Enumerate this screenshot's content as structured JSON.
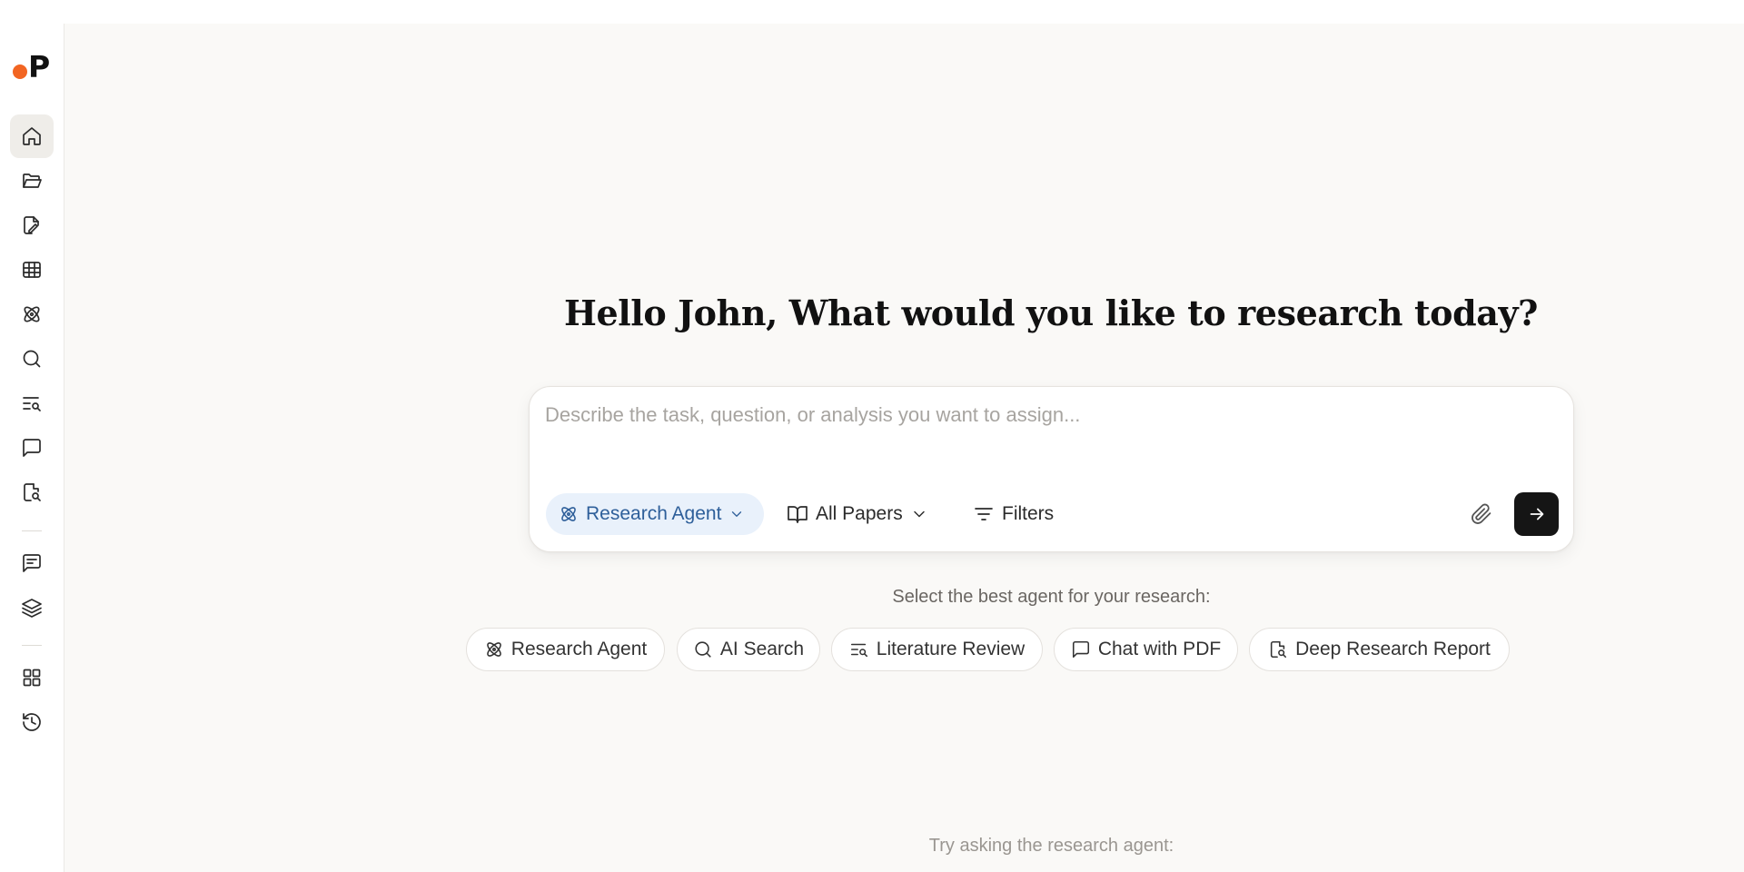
{
  "brand": {
    "logo_letter": "P",
    "accent_color": "#f26522"
  },
  "sidebar": {
    "items": [
      {
        "name": "home",
        "icon": "home-icon",
        "active": true
      },
      {
        "name": "folders",
        "icon": "folder-open-icon"
      },
      {
        "name": "edit-document",
        "icon": "file-pen-icon"
      },
      {
        "name": "table",
        "icon": "table-icon"
      },
      {
        "name": "research-agent",
        "icon": "atom-icon"
      },
      {
        "name": "ai-search",
        "icon": "search-icon"
      },
      {
        "name": "literature-review",
        "icon": "text-search-icon"
      },
      {
        "name": "chat",
        "icon": "message-square-icon"
      },
      {
        "name": "deep-research-report",
        "icon": "file-search-icon"
      },
      {
        "name": "notes",
        "icon": "message-square-text-icon"
      },
      {
        "name": "layers",
        "icon": "layers-icon"
      },
      {
        "name": "apps",
        "icon": "grid-icon"
      },
      {
        "name": "history",
        "icon": "history-icon"
      }
    ]
  },
  "main": {
    "greeting": "Hello John, What would you like to research today?",
    "composer": {
      "placeholder": "Describe the task, question, or analysis you want to assign...",
      "agent_select": "Research Agent",
      "source_select": "All Papers",
      "filters_label": "Filters"
    },
    "agent_prompt": "Select the best agent for your research:",
    "agents": [
      {
        "label": "Research Agent",
        "icon": "atom-icon"
      },
      {
        "label": "AI Search",
        "icon": "search-icon"
      },
      {
        "label": "Literature Review",
        "icon": "text-search-icon"
      },
      {
        "label": "Chat with PDF",
        "icon": "message-square-icon"
      },
      {
        "label": "Deep Research Report",
        "icon": "file-search-icon"
      }
    ],
    "try_prompt": "Try asking the research agent:"
  }
}
